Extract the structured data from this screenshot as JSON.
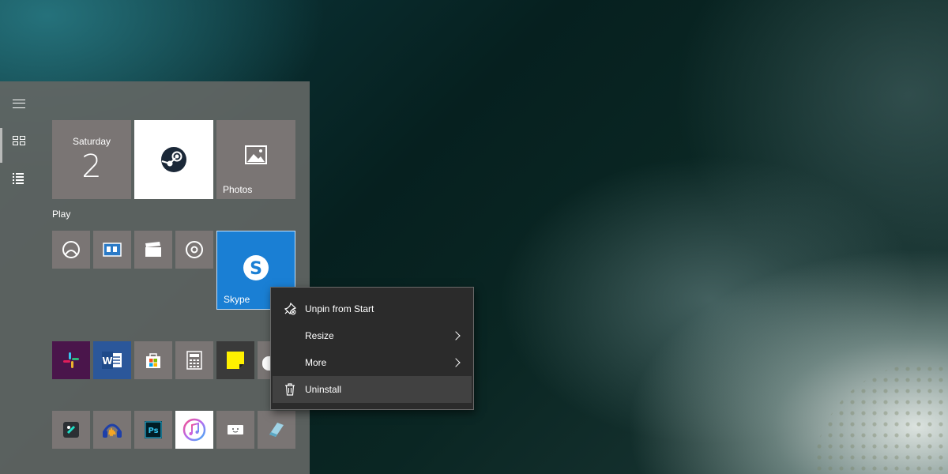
{
  "start_menu": {
    "rail": {
      "items": [
        {
          "icon": "hamburger-icon"
        },
        {
          "icon": "all-tiles-icon"
        },
        {
          "icon": "app-list-icon"
        }
      ]
    },
    "date_tile": {
      "day": "Saturday",
      "date": "2"
    },
    "tiles": {
      "steam": {
        "icon": "steam-icon"
      },
      "photos": {
        "label": "Photos",
        "icon": "photos-icon"
      },
      "skype": {
        "label": "Skype",
        "icon": "skype-icon",
        "color": "#1a7fd4"
      }
    },
    "group_label": "Play",
    "play_tiles": [
      {
        "icon": "xbox-icon"
      },
      {
        "icon": "solitaire-icon"
      },
      {
        "icon": "movies-icon"
      },
      {
        "icon": "groove-music-icon"
      }
    ],
    "row3_tiles": [
      {
        "icon": "slack-icon",
        "color": "#4a154b"
      },
      {
        "icon": "word-icon",
        "color": "#2b579a"
      },
      {
        "icon": "store-icon"
      },
      {
        "icon": "calculator-icon"
      },
      {
        "icon": "sticky-notes-icon",
        "color": "#3a3a3a"
      }
    ],
    "row4_tiles": [
      {
        "icon": "filmora-icon"
      },
      {
        "icon": "audacity-icon"
      },
      {
        "icon": "photoshop-icon"
      },
      {
        "icon": "itunes-icon",
        "color": "#ffffff"
      },
      {
        "icon": "game-icon"
      },
      {
        "icon": "eraser-icon"
      }
    ]
  },
  "context_menu": {
    "items": [
      {
        "label": "Unpin from Start",
        "icon": "unpin-icon"
      },
      {
        "label": "Resize",
        "submenu": true
      },
      {
        "label": "More",
        "submenu": true
      },
      {
        "label": "Uninstall",
        "icon": "trash-icon"
      }
    ]
  }
}
